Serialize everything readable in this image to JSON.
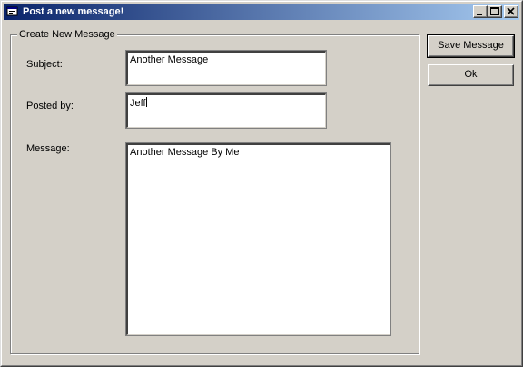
{
  "window": {
    "title": "Post a new message!"
  },
  "title_buttons": {
    "minimize_icon": "minimize-icon",
    "maximize_icon": "maximize-icon",
    "close_icon": "close-icon"
  },
  "group": {
    "label": "Create New Message"
  },
  "fields": {
    "subject_label": "Subject:",
    "subject_value": "Another Message",
    "posted_by_label": "Posted by:",
    "posted_by_value": "Jeff",
    "message_label": "Message:",
    "message_value": "Another Message By Me"
  },
  "buttons": {
    "save_label": "Save Message",
    "ok_label": "Ok"
  },
  "colors": {
    "title_gradient_start": "#0a246a",
    "title_gradient_end": "#a6caf0",
    "face": "#d4d0c8"
  }
}
